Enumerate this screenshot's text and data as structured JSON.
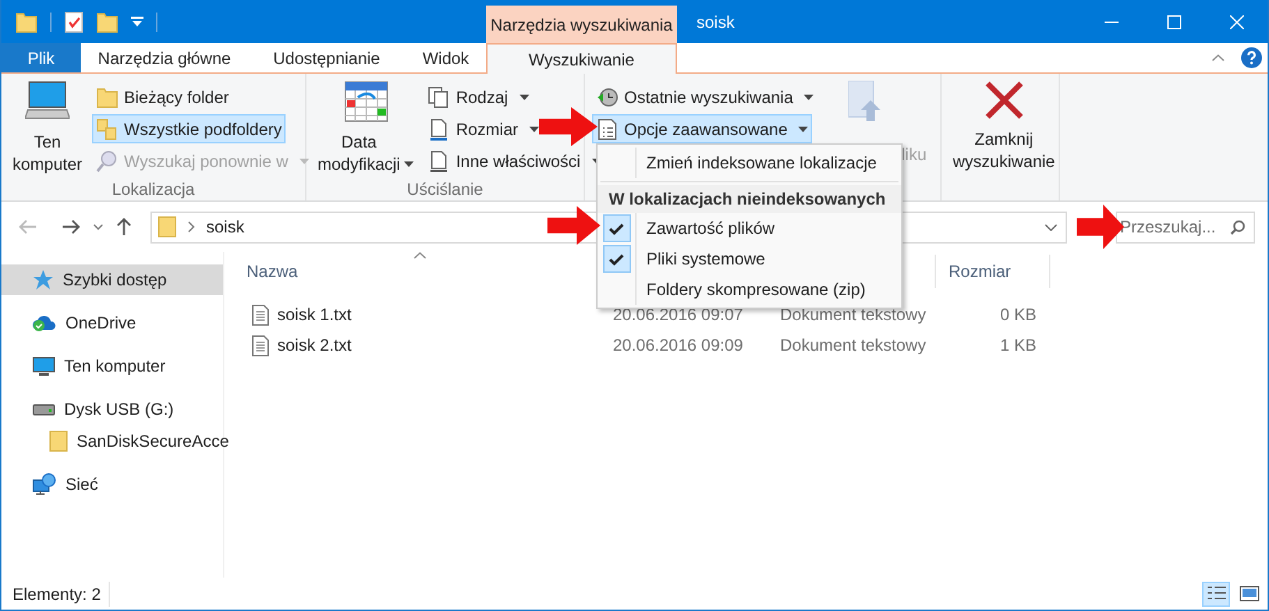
{
  "title_bar": {
    "context_tab": "Narzędzia wyszukiwania",
    "title": "soisk"
  },
  "ribbon_tabs": [
    {
      "label": "Plik",
      "kind": "file",
      "selected": false
    },
    {
      "label": "Narzędzia główne",
      "kind": "tab",
      "selected": false
    },
    {
      "label": "Udostępnianie",
      "kind": "tab",
      "selected": false
    },
    {
      "label": "Widok",
      "kind": "tab",
      "selected": false
    },
    {
      "label": "Wyszukiwanie",
      "kind": "tab",
      "selected": true
    }
  ],
  "ribbon_groups": [
    {
      "label": "Lokalizacja",
      "items": [
        {
          "kind": "large",
          "label": "Ten komputer",
          "selected": false,
          "disabled": false,
          "dropdown": false
        },
        {
          "kind": "small",
          "label": "Bieżący folder",
          "selected": false,
          "disabled": false,
          "dropdown": false
        },
        {
          "kind": "small",
          "label": "Wszystkie podfoldery",
          "selected": true,
          "disabled": false,
          "dropdown": false
        },
        {
          "kind": "small",
          "label": "Wyszukaj ponownie w",
          "selected": false,
          "disabled": true,
          "dropdown": true
        }
      ]
    },
    {
      "label": "Uściślanie",
      "items": [
        {
          "kind": "large",
          "label": "Data modyfikacji",
          "selected": false,
          "disabled": false,
          "dropdown": true
        },
        {
          "kind": "small",
          "label": "Rodzaj",
          "selected": false,
          "disabled": false,
          "dropdown": true
        },
        {
          "kind": "small",
          "label": "Rozmiar",
          "selected": false,
          "disabled": false,
          "dropdown": true
        },
        {
          "kind": "small",
          "label": "Inne właściwości",
          "selected": false,
          "disabled": false,
          "dropdown": true
        }
      ]
    },
    {
      "items": [
        {
          "kind": "small",
          "label": "Ostatnie wyszukiwania",
          "selected": false,
          "disabled": false,
          "dropdown": true
        },
        {
          "kind": "small",
          "label": "Opcje zaawansowane",
          "selected": true,
          "disabled": false,
          "dropdown": true
        },
        {
          "kind": "large",
          "label": "liku",
          "selected": false,
          "disabled": true,
          "dropdown": false
        }
      ]
    },
    {
      "items": [
        {
          "kind": "large",
          "label": "Zamknij wyszukiwanie",
          "selected": false,
          "disabled": false,
          "dropdown": false
        }
      ]
    }
  ],
  "navigation": {
    "back": {
      "disabled": true
    },
    "forward": {
      "disabled": false
    }
  },
  "address_bar": {
    "path": "soisk"
  },
  "search": {
    "placeholder": "Przeszukaj..."
  },
  "navigation_pane": [
    {
      "label": "Szybki dostęp",
      "selected": true
    },
    {
      "label": "OneDrive",
      "selected": false
    },
    {
      "label": "Ten komputer",
      "selected": false
    },
    {
      "label": "Dysk USB (G:)",
      "selected": false,
      "children": [
        {
          "label": "SanDiskSecureAcce",
          "selected": false
        }
      ]
    },
    {
      "label": "Sieć",
      "selected": false
    }
  ],
  "file_list": {
    "headers": {
      "name": "Nazwa",
      "size": "Rozmiar"
    },
    "rows": [
      {
        "name": "soisk 1.txt",
        "date": "20.06.2016 09:07",
        "type": "Dokument tekstowy",
        "size": "0 KB"
      },
      {
        "name": "soisk 2.txt",
        "date": "20.06.2016 09:09",
        "type": "Dokument tekstowy",
        "size": "1 KB"
      }
    ]
  },
  "dropdown_menu": [
    {
      "kind": "command",
      "label": "Zmień indeksowane lokalizacje"
    },
    {
      "kind": "header",
      "label": "W lokalizacjach nieindeksowanych"
    },
    {
      "kind": "check",
      "label": "Zawartość plików",
      "checked": true
    },
    {
      "kind": "check",
      "label": "Pliki systemowe",
      "checked": true
    },
    {
      "kind": "check",
      "label": "Foldery skompresowane (zip)",
      "checked": false
    }
  ],
  "status_bar": {
    "item_count": "Elementy: 2",
    "views": [
      {
        "selected": true
      },
      {
        "selected": false
      }
    ]
  }
}
